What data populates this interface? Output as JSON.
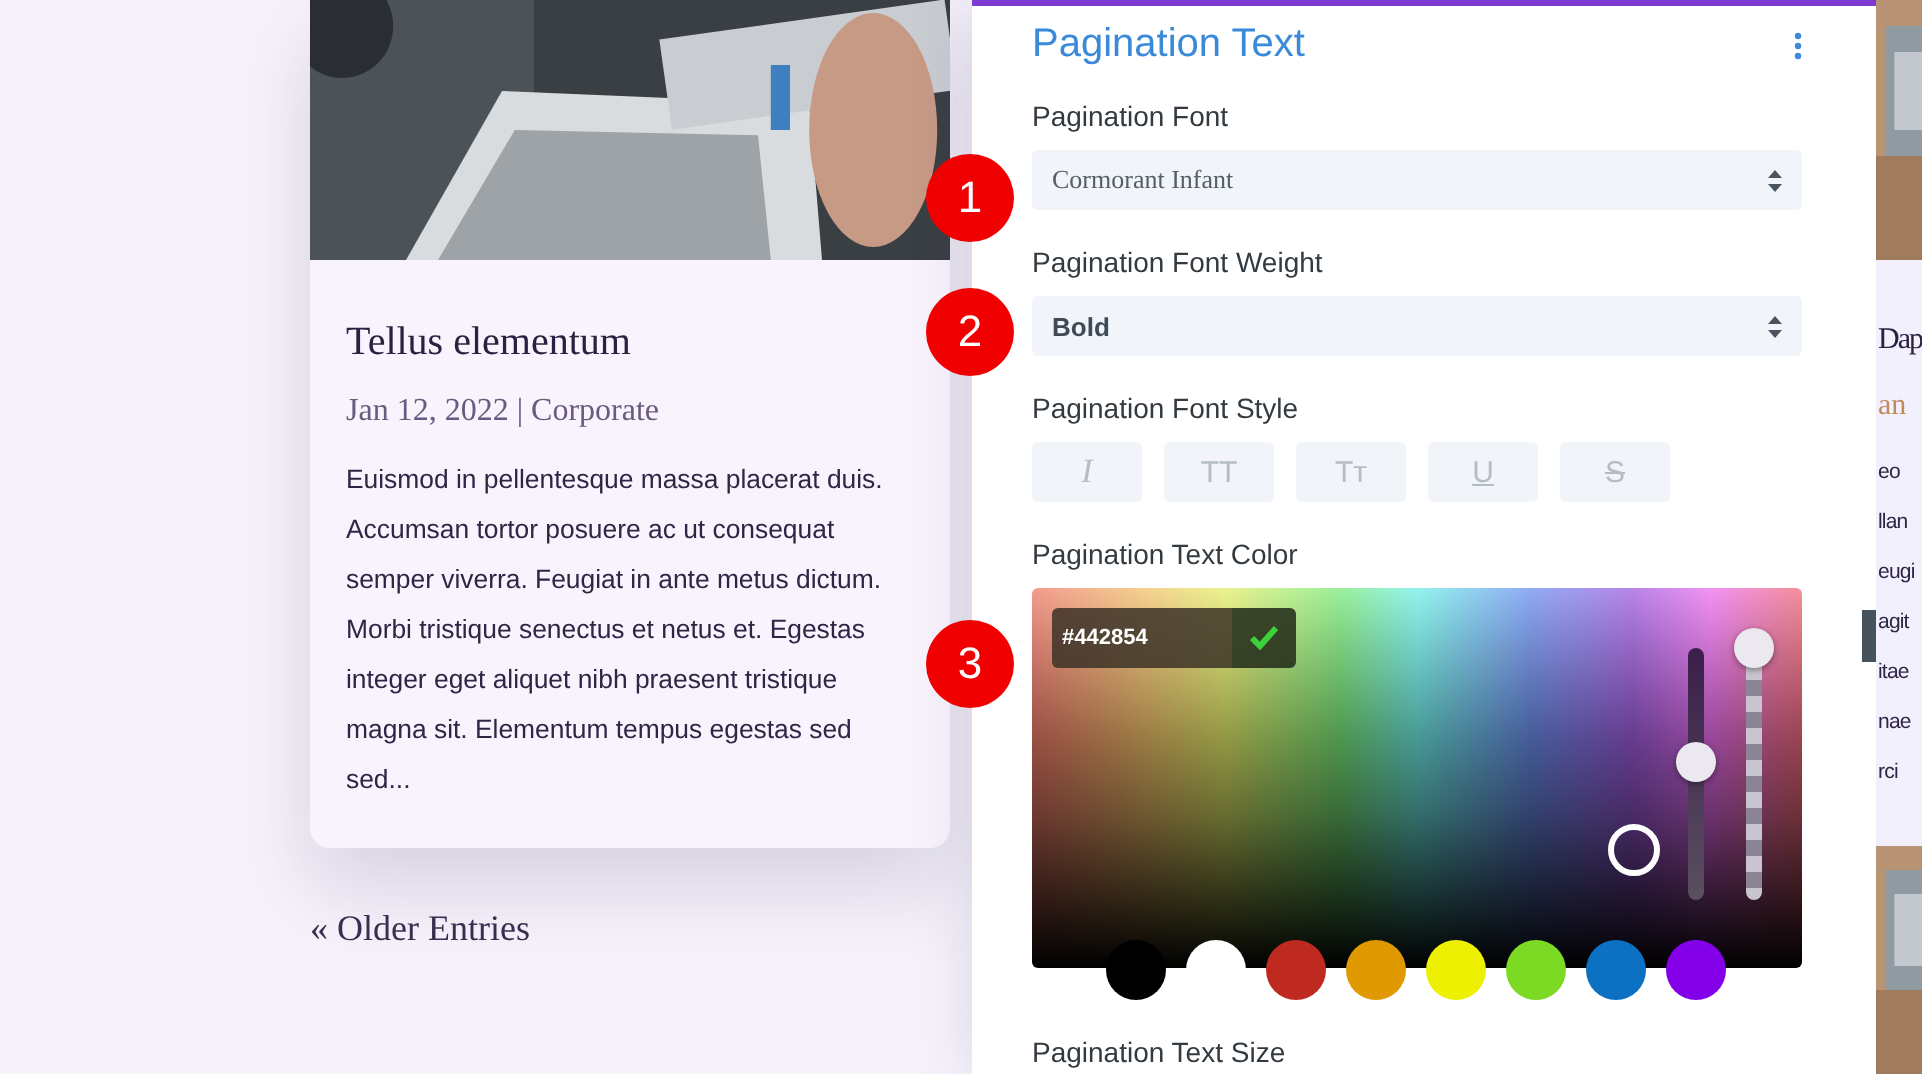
{
  "left_post": {
    "title": "Tellus elementum",
    "meta": "Jan 12, 2022 | Corporate",
    "excerpt": "Euismod in pellentesque massa placerat duis. Accumsan tortor posuere ac ut consequat semper viverra. Feugiat in ante metus dictum. Morbi tristique senectus et netus et. Egestas integer eget aliquet nibh praesent tristique magna sit. Elementum tempus egestas sed sed..."
  },
  "pagination_link": "« Older Entries",
  "right_post": {
    "title": "Dap",
    "meta": "an",
    "excerpt_lines": [
      "eo",
      "llan",
      "eugi",
      "agit",
      "itae",
      "nae",
      "rci"
    ]
  },
  "panel": {
    "title": "Pagination Text",
    "fields": [
      {
        "kind": "font-select",
        "label": "Pagination Font",
        "value": "Cormorant Infant"
      },
      {
        "kind": "select",
        "label": "Pagination Font Weight",
        "value": "Bold"
      },
      {
        "kind": "styles",
        "label": "Pagination Font Style",
        "buttons": [
          {
            "glyph": "I",
            "on": false
          },
          {
            "glyph": "TT",
            "on": false
          },
          {
            "glyph": "Tт",
            "on": false
          },
          {
            "glyph": "U",
            "on": false
          },
          {
            "glyph": "S",
            "on": false
          }
        ]
      },
      {
        "kind": "color",
        "label": "Pagination Text Color",
        "hex": "#442854",
        "sliders": [
          {
            "kind": "hue",
            "level": 0.55
          },
          {
            "kind": "alpha",
            "level": 1
          }
        ],
        "swatches": [
          {
            "color": "#000000"
          },
          {
            "color": "#ffffff"
          },
          {
            "color": "#be2a1f"
          },
          {
            "color": "#e09900"
          },
          {
            "color": "#edf000"
          },
          {
            "color": "#7cda24"
          },
          {
            "color": "#0c71c3"
          },
          {
            "color": "#8300e9"
          }
        ]
      },
      {
        "kind": "heading",
        "label": "Pagination Text Size"
      }
    ]
  },
  "callouts": [
    "1",
    "2",
    "3"
  ]
}
